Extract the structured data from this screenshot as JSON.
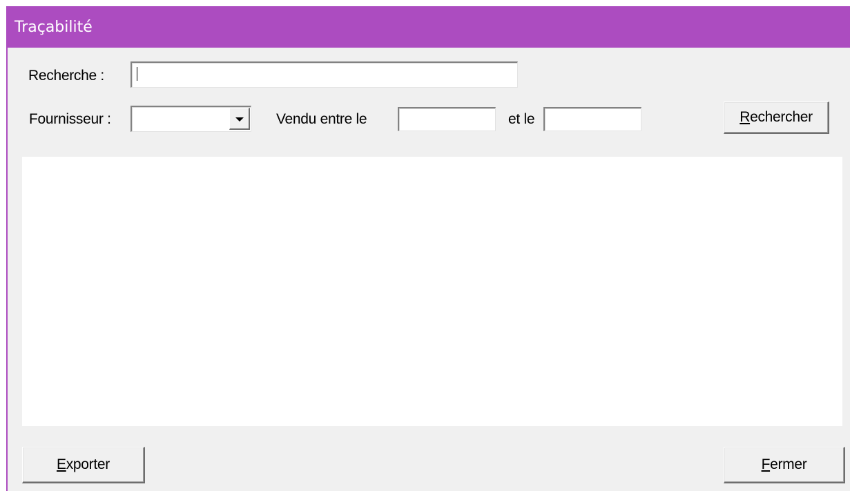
{
  "window": {
    "title": "Traçabilité"
  },
  "search": {
    "label": "Recherche :",
    "value": ""
  },
  "filters": {
    "supplier_label": "Fournisseur :",
    "supplier_value": "",
    "sold_between_label": "Vendu entre le",
    "date_from_value": "",
    "and_label": "et le",
    "date_to_value": ""
  },
  "buttons": {
    "search_accel": "R",
    "search_rest": "echercher",
    "export_accel": "E",
    "export_rest": "xporter",
    "close_accel": "F",
    "close_rest": "ermer"
  },
  "colors": {
    "titlebar": "#ac4cc0",
    "window_bg": "#f0f0f0"
  },
  "icons": {
    "dropdown": "chevron-down-icon"
  }
}
